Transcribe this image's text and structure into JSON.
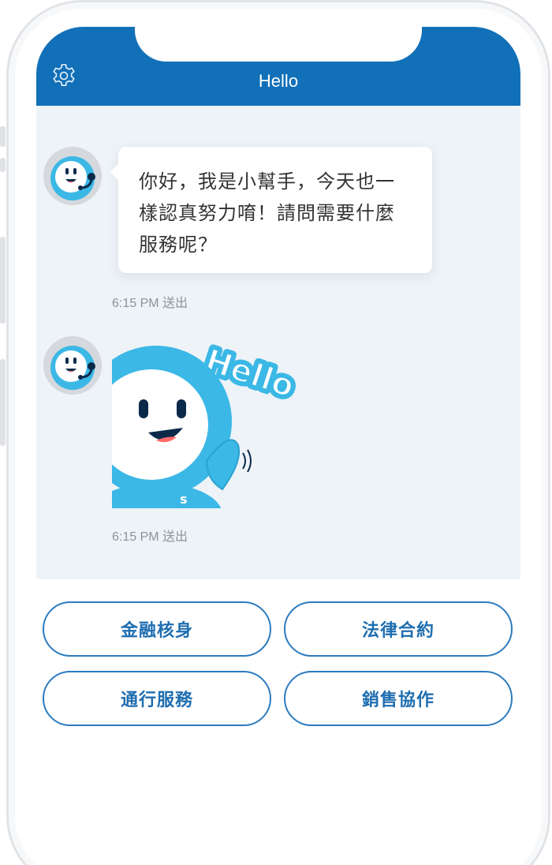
{
  "header": {
    "title": "Hello",
    "settings_icon": "gear-icon"
  },
  "messages": [
    {
      "sender": "bot",
      "text": "你好，我是小幫手，今天也一\n樣認真努力唷！請問需要什麼\n服務呢？",
      "text_lines": [
        "你好，我是小幫手，今天也一",
        "樣認真努力唷！請問需要什麼",
        "服務呢？"
      ],
      "time": "6:15 PM 送出"
    },
    {
      "sender": "bot",
      "sticker": "hello-mascot-sticker",
      "sticker_text": "Hello",
      "time": "6:15 PM 送出"
    }
  ],
  "quick_replies": [
    {
      "label": "金融核身"
    },
    {
      "label": "法律合約"
    },
    {
      "label": "通行服務"
    },
    {
      "label": "銷售協作"
    }
  ],
  "colors": {
    "header": "#1270b8",
    "chat_background": "#eef3f7",
    "button_border": "#2b7bbf",
    "button_text": "#1f6eb0",
    "mascot": "#3bb8e6"
  }
}
